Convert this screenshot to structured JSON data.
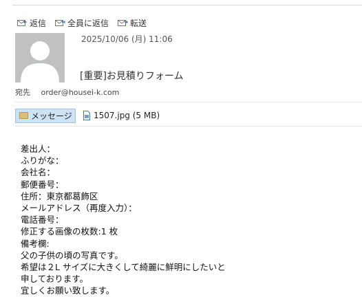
{
  "toolbar": {
    "reply": "返信",
    "reply_all": "全員に返信",
    "forward": "転送"
  },
  "message": {
    "date": "2025/10/06 (月) 11:06",
    "subject": "[重要]お見積りフォーム",
    "to_label": "宛先",
    "to": "order@housei-k.com"
  },
  "attachments": {
    "message_tab": "メッセージ",
    "file": "1507.jpg (5 MB)"
  },
  "body_lines": [
    "差出人：",
    "ふりがな：",
    "会社名：",
    "郵便番号：",
    "住所：東京都葛飾区",
    "メールアドレス（再度入力）：",
    "電話番号：",
    "修正する画像の枚数:1 枚",
    "備考欄:",
    "父の子供の頃の写真です。",
    "希望は２L サイズに大きくして綺麗に鮮明にしたいと",
    "申しております。",
    "宜しくお願い致します。"
  ]
}
